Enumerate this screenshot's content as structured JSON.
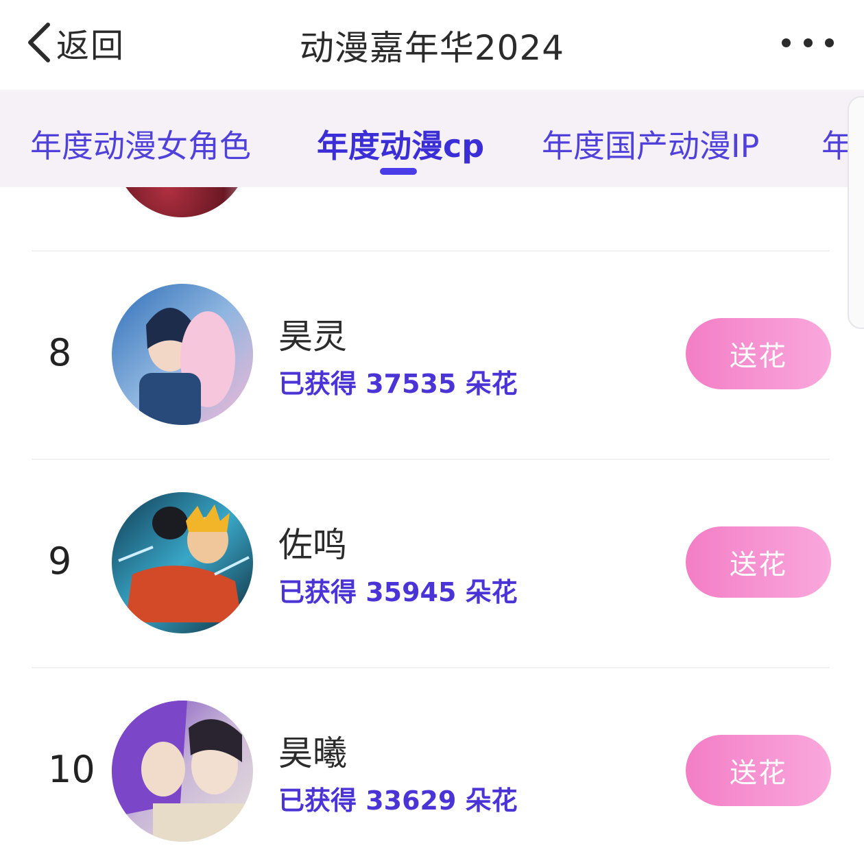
{
  "header": {
    "back_label": "返回",
    "title": "动漫嘉年华2024"
  },
  "tabs": [
    {
      "label": "年度动漫女角色",
      "active": false
    },
    {
      "label": "年度动漫cp",
      "active": true
    },
    {
      "label": "年度国产动漫IP",
      "active": false
    },
    {
      "label": "年度",
      "active": false
    }
  ],
  "items": [
    {
      "rank": "8",
      "name": "昊灵",
      "score_text": "已获得 37535 朵花",
      "button_label": "送花"
    },
    {
      "rank": "9",
      "name": "佐鸣",
      "score_text": "已获得 35945 朵花",
      "button_label": "送花"
    },
    {
      "rank": "10",
      "name": "昊曦",
      "score_text": "已获得 33629 朵花",
      "button_label": "送花"
    }
  ],
  "colors": {
    "accent": "#4a3ce8",
    "button": "#f37ec6",
    "tab_bar": "#f6f1f7"
  },
  "icons": {
    "back": "chevron-left-icon",
    "more": "more-dots-icon"
  }
}
